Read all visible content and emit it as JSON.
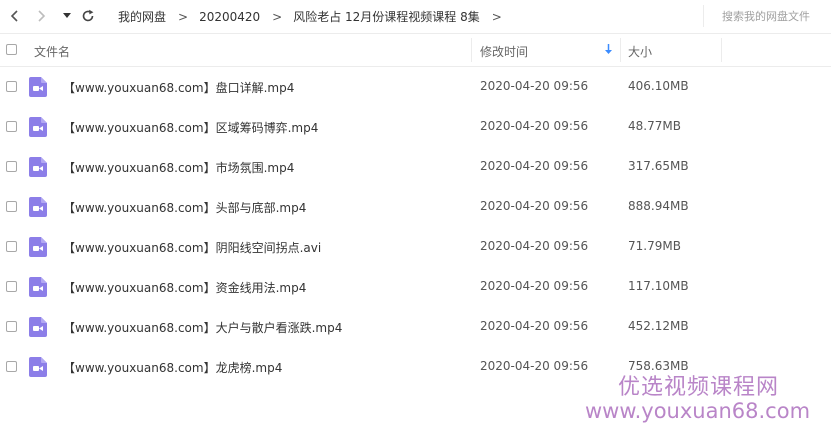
{
  "breadcrumb": {
    "items": [
      "我的网盘",
      "20200420",
      "风险老占 12月份课程视频课程 8集"
    ],
    "separator": ">"
  },
  "search": {
    "placeholder": "搜索我的网盘文件"
  },
  "columns": {
    "name": "文件名",
    "modified": "修改时间",
    "size": "大小"
  },
  "files": [
    {
      "name": "【www.youxuan68.com】盘口详解.mp4",
      "modified": "2020-04-20 09:56",
      "size": "406.10MB"
    },
    {
      "name": "【www.youxuan68.com】区域筹码博弈.mp4",
      "modified": "2020-04-20 09:56",
      "size": "48.77MB"
    },
    {
      "name": "【www.youxuan68.com】市场氛围.mp4",
      "modified": "2020-04-20 09:56",
      "size": "317.65MB"
    },
    {
      "name": "【www.youxuan68.com】头部与底部.mp4",
      "modified": "2020-04-20 09:56",
      "size": "888.94MB"
    },
    {
      "name": "【www.youxuan68.com】阴阳线空间拐点.avi",
      "modified": "2020-04-20 09:56",
      "size": "71.79MB"
    },
    {
      "name": "【www.youxuan68.com】资金线用法.mp4",
      "modified": "2020-04-20 09:56",
      "size": "117.10MB"
    },
    {
      "name": "【www.youxuan68.com】大户与散户看涨跌.mp4",
      "modified": "2020-04-20 09:56",
      "size": "452.12MB"
    },
    {
      "name": "【www.youxuan68.com】龙虎榜.mp4",
      "modified": "2020-04-20 09:56",
      "size": "758.63MB"
    }
  ],
  "watermark": {
    "line1": "优选视频课程网",
    "line2": "www.youxuan68.com"
  },
  "icons": {
    "back": "chevron-left-icon",
    "forward": "chevron-right-icon",
    "history": "caret-down-icon",
    "refresh": "refresh-icon",
    "sort": "sort-desc-arrow-icon",
    "file": "video-file-icon"
  },
  "colors": {
    "file_icon": "#8c7ee8",
    "sort_arrow": "#3b8cff",
    "watermark": "#b985c8"
  }
}
